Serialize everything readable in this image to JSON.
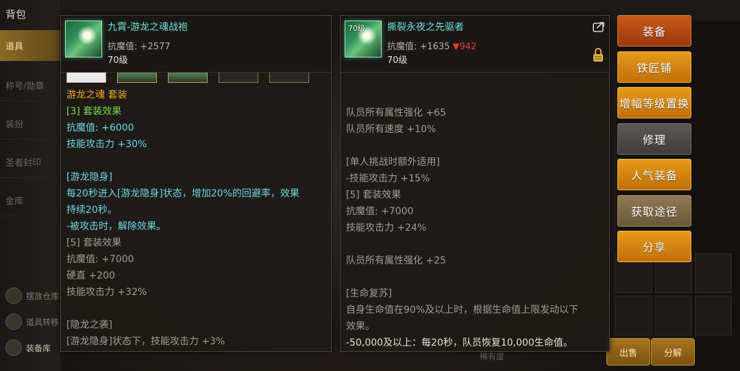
{
  "background": {
    "title": "背包",
    "tabs": [
      "道具",
      "称号/勋章",
      "装扮",
      "圣者封印",
      "金库"
    ],
    "bottom_items": [
      "摆放仓库",
      "道具转移",
      "装备库"
    ],
    "sell_label": "出售",
    "decompose_label": "分解",
    "filter_label": "稀有度"
  },
  "left_panel": {
    "name": "九霄-游龙之魂战袍",
    "stat": "抗魔值: +2577",
    "level": "70级",
    "lines": [
      {
        "text": "游龙之魂 套装",
        "color": "gold"
      },
      {
        "text": "[3] 套装效果",
        "color": "green"
      },
      {
        "text": "抗魔值: +6000",
        "color": "cyan"
      },
      {
        "text": "技能攻击力 +30%",
        "color": "cyan"
      },
      {
        "text": "",
        "color": "grey"
      },
      {
        "text": "[游龙隐身]",
        "color": "cyan"
      },
      {
        "text": "每20秒进入[游龙隐身]状态，增加20%的回避率，效果",
        "color": "cyan"
      },
      {
        "text": "持续20秒。",
        "color": "cyan"
      },
      {
        "text": "-被攻击时，解除效果。",
        "color": "cyan"
      },
      {
        "text": "[5] 套装效果",
        "color": "grey"
      },
      {
        "text": "抗魔值: +7000",
        "color": "grey"
      },
      {
        "text": "硬直 +200",
        "color": "grey"
      },
      {
        "text": "技能攻击力 +32%",
        "color": "grey"
      },
      {
        "text": "",
        "color": "grey"
      },
      {
        "text": "[隐龙之袭]",
        "color": "grey"
      },
      {
        "text": "[游龙隐身]状态下，技能攻击力 +3%",
        "color": "grey"
      }
    ]
  },
  "right_panel": {
    "name": "撕裂永夜之先驱者",
    "icon_level": "70级",
    "stat": "抗魔值: +1635",
    "stat_diff": "▼942",
    "level": "70级",
    "lines": [
      {
        "text": "",
        "color": "grey"
      },
      {
        "text": "",
        "color": "grey"
      },
      {
        "text": "队员所有属性强化 +65",
        "color": "grey"
      },
      {
        "text": "队员所有速度 +10%",
        "color": "grey"
      },
      {
        "text": "",
        "color": "grey"
      },
      {
        "text": "[单人挑战时额外适用]",
        "color": "grey"
      },
      {
        "text": "-技能攻击力 +15%",
        "color": "grey"
      },
      {
        "text": "[5] 套装效果",
        "color": "grey"
      },
      {
        "text": "抗魔值: +7000",
        "color": "grey"
      },
      {
        "text": "技能攻击力 +24%",
        "color": "grey"
      },
      {
        "text": "",
        "color": "grey"
      },
      {
        "text": "队员所有属性强化 +25",
        "color": "grey"
      },
      {
        "text": "",
        "color": "grey"
      },
      {
        "text": "[生命复苏]",
        "color": "grey"
      },
      {
        "text": "自身生命值在90%及以上时，根据生命值上限发动以下",
        "color": "grey"
      },
      {
        "text": "效果。",
        "color": "grey"
      },
      {
        "text": "-50,000及以上：每20秒，队员恢复10,000生命值。",
        "color": "white"
      }
    ]
  },
  "actions": [
    {
      "label": "装备",
      "style": "red"
    },
    {
      "label": "铁匠铺",
      "style": "orange"
    },
    {
      "label": "增幅等级置换",
      "style": "orange"
    },
    {
      "label": "修理",
      "style": "grey"
    },
    {
      "label": "人气装备",
      "style": "orange"
    },
    {
      "label": "获取途径",
      "style": "tan"
    },
    {
      "label": "分享",
      "style": "orange"
    }
  ],
  "colors": {
    "name_cyan": "#6fe0d8",
    "set_gold": "#f5a623",
    "set_green": "#7bd94e",
    "effect_cyan": "#6fd6e8",
    "inactive_grey": "#a29c90",
    "stat_down_red": "#f03a3a",
    "button_orange": "#d8860f"
  }
}
